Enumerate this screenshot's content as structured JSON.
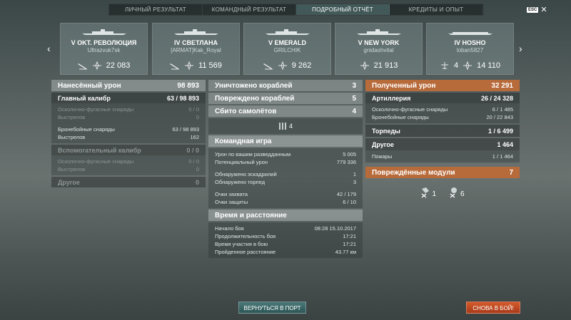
{
  "tabs": [
    "ЛИЧНЫЙ РЕЗУЛЬТАТ",
    "КОМАНДНЫЙ РЕЗУЛЬТАТ",
    "ПОДРОБНЫЙ ОТЧЁТ",
    "КРЕДИТЫ И ОПЫТ"
  ],
  "active_tab": 2,
  "esc": {
    "key": "ESC",
    "close": "✕"
  },
  "arrows": {
    "left": "‹",
    "right": "›"
  },
  "ships": [
    {
      "name": "V OKT. РЕВОЛЮЦИЯ",
      "player": "Ultrazvuk7sk",
      "extra": "",
      "value": "22 083"
    },
    {
      "name": "IV СВЕТЛАНА",
      "player": "[ARMAT]Kak_Royal",
      "extra": "",
      "value": "11 569"
    },
    {
      "name": "V EMERALD",
      "player": "GRILCHIK",
      "extra": "",
      "value": "9 262"
    },
    {
      "name": "V NEW YORK",
      "player": "gnidashvital",
      "extra": "",
      "value": "21 913"
    },
    {
      "name": "IV HOSHO",
      "player": "loban5827",
      "extra": "4",
      "value": "14 110"
    }
  ],
  "left": {
    "dmg": {
      "label": "Нанесённый урон",
      "value": "98 893"
    },
    "main": {
      "label": "Главный калибр",
      "value": "63 / 98 893"
    },
    "he": {
      "label": "Осколочно-фугасные снаряды",
      "value": "0 / 0"
    },
    "he_shots": {
      "label": "Выстрелов",
      "value": "0"
    },
    "ap": {
      "label": "Бронебойные снаряды",
      "value": "63 / 98 893"
    },
    "ap_shots": {
      "label": "Выстрелов",
      "value": "162"
    },
    "sec": {
      "label": "Вспомогательный калибр",
      "value": "0 / 0"
    },
    "sec_he": {
      "label": "Осколочно-фугасные снаряды",
      "value": "0 / 0"
    },
    "sec_shots": {
      "label": "Выстрелов",
      "value": "0"
    },
    "other": {
      "label": "Другое",
      "value": "0"
    }
  },
  "mid": {
    "destroyed": {
      "label": "Уничтожено кораблей",
      "value": "3"
    },
    "damaged": {
      "label": "Повреждено кораблей",
      "value": "5"
    },
    "planes": {
      "label": "Сбито самолётов",
      "value": "4"
    },
    "planes_count": "4",
    "team": {
      "title": "Командная игра",
      "rows": [
        {
          "label": "Урон по вашим разведданным",
          "value": "5 005"
        },
        {
          "label": "Потенциальный урон",
          "value": "779 336"
        },
        {
          "label": "Обнаружено эскадрилий",
          "value": "1"
        },
        {
          "label": "Обнаружено торпед",
          "value": "3"
        },
        {
          "label": "Очки захвата",
          "value": "42 / 179"
        },
        {
          "label": "Очки защиты",
          "value": "6 / 10"
        }
      ]
    },
    "time": {
      "title": "Время и расстояние",
      "rows": [
        {
          "label": "Начало боя",
          "value": "08:28  15.10.2017"
        },
        {
          "label": "Продолжительность боя",
          "value": "17:21"
        },
        {
          "label": "Время участия в бою",
          "value": "17:21"
        },
        {
          "label": "Пройденное расстояние",
          "value": "43.77 км"
        }
      ]
    }
  },
  "right": {
    "received": {
      "label": "Полученный урон",
      "value": "32 291"
    },
    "art": {
      "label": "Артиллерия",
      "value": "26 / 24 328"
    },
    "he": {
      "label": "Осколочно-фугасные снаряды",
      "value": "6 / 1 485"
    },
    "ap": {
      "label": "Бронебойные снаряды",
      "value": "20 / 22 843"
    },
    "torp": {
      "label": "Торпеды",
      "value": "1 / 6 499"
    },
    "other": {
      "label": "Другое",
      "value": "1 464"
    },
    "fires": {
      "label": "Пожары",
      "value": "1 / 1 464"
    },
    "modules": {
      "label": "Повреждённые модули",
      "value": "7"
    },
    "mod1": "1",
    "mod2": "6"
  },
  "buttons": {
    "port": "ВЕРНУТЬСЯ В ПОРТ",
    "battle": "СНОВА В БОЙ!"
  }
}
